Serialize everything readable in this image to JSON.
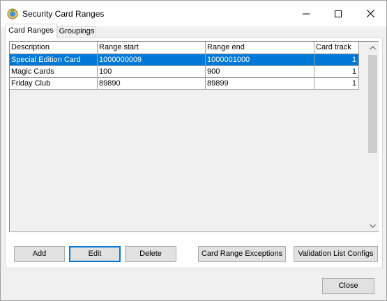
{
  "window": {
    "title": "Security Card Ranges"
  },
  "tabs": [
    {
      "label": "Card Ranges",
      "active": true
    },
    {
      "label": "Groupings",
      "active": false
    }
  ],
  "grid": {
    "columns": [
      "Description",
      "Range start",
      "Range end",
      "Card track"
    ],
    "rows": [
      {
        "description": "Special Edition Card",
        "range_start": "1000000009",
        "range_end": "1000001000",
        "card_track": "1",
        "selected": true
      },
      {
        "description": "Magic Cards",
        "range_start": "100",
        "range_end": "900",
        "card_track": "1",
        "selected": false
      },
      {
        "description": "Friday Club",
        "range_start": "89890",
        "range_end": "89899",
        "card_track": "1",
        "selected": false
      }
    ]
  },
  "buttons": {
    "add": "Add",
    "edit": "Edit",
    "delete": "Delete",
    "card_range_exceptions": "Card Range Exceptions",
    "validation_list_configs": "Validation List Configs",
    "close": "Close"
  },
  "colors": {
    "selection": "#0078d7",
    "window_bg": "#f0f0f0",
    "button_bg": "#e1e1e1"
  }
}
